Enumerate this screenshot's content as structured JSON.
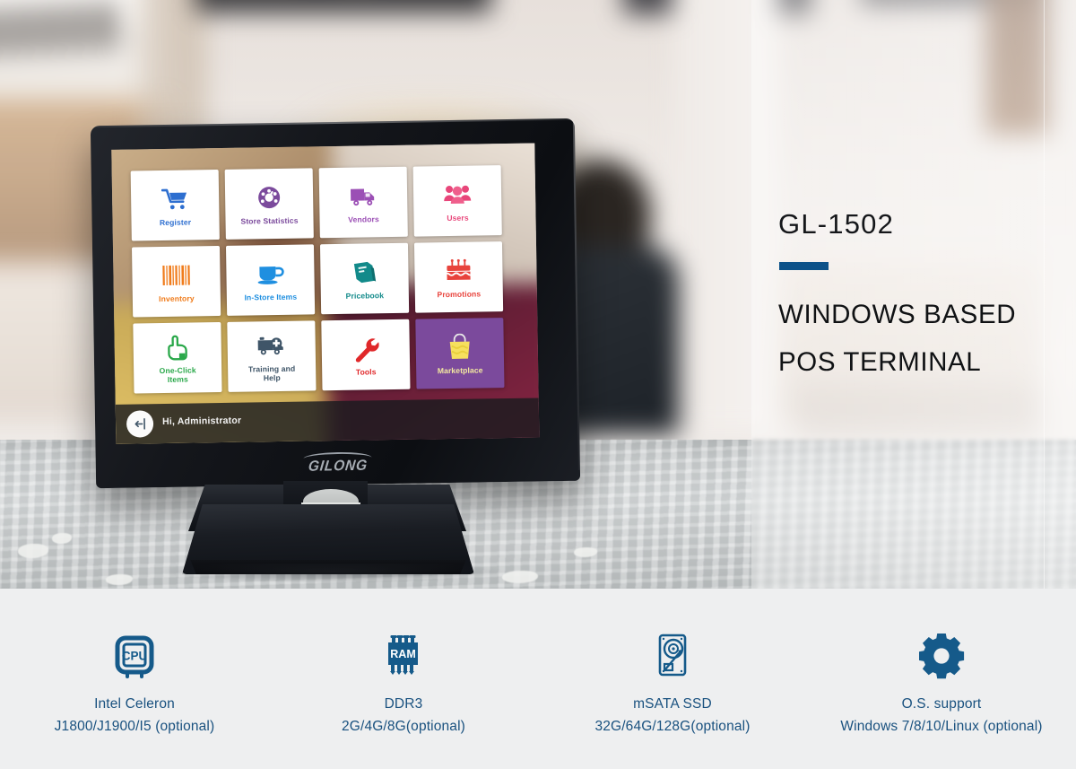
{
  "hero": {
    "product_code": "GL-1502",
    "title_line1": "WINDOWS BASED",
    "title_line2": "POS TERMINAL",
    "accent_color": "#0d5289"
  },
  "device": {
    "brand_logo": "GILONG",
    "taskbar": {
      "user_greeting": "Hi, Administrator",
      "avatar_icon": "logout-arrow-icon"
    },
    "tiles": [
      {
        "label": "Register",
        "icon": "shopping-cart-icon",
        "color": "#2e6fd0"
      },
      {
        "label": "Store Statistics",
        "icon": "gauge-icon",
        "color": "#7b4a9c"
      },
      {
        "label": "Vendors",
        "icon": "delivery-truck-icon",
        "color": "#9b4fb5"
      },
      {
        "label": "Users",
        "icon": "users-group-icon",
        "color": "#e8467a"
      },
      {
        "label": "Inventory",
        "icon": "barcode-icon",
        "color": "#f07c1c"
      },
      {
        "label": "In-Store Items",
        "icon": "coffee-cup-icon",
        "color": "#1f8fe0"
      },
      {
        "label": "Pricebook",
        "icon": "book-icon",
        "color": "#128a8a"
      },
      {
        "label": "Promotions",
        "icon": "birthday-cake-icon",
        "color": "#e8433c"
      },
      {
        "label": "One-Click\nItems",
        "icon": "pointing-hand-icon",
        "color": "#2aa84a"
      },
      {
        "label": "Training and\nHelp",
        "icon": "ambulance-icon",
        "color": "#3f5568"
      },
      {
        "label": "Tools",
        "icon": "wrench-icon",
        "color": "#e0282a"
      },
      {
        "label": "Marketplace",
        "icon": "shopping-bag-icon",
        "color": "#f6e05e"
      }
    ]
  },
  "specs": [
    {
      "icon": "cpu-chip-icon",
      "title": "Intel Celeron",
      "sub": "J1800/J1900/I5 (optional)"
    },
    {
      "icon": "ram-chip-icon",
      "title": "DDR3",
      "sub": "2G/4G/8G(optional)"
    },
    {
      "icon": "hard-drive-icon",
      "title": "mSATA SSD",
      "sub": "32G/64G/128G(optional)"
    },
    {
      "icon": "gear-icon",
      "title": "O.S. support",
      "sub": "Windows 7/8/10/Linux (optional)"
    }
  ],
  "theme": {
    "spec_text_color": "#19517f",
    "spec_bar_bg": "#eeeff0",
    "tile_accent_bg": "#7b4a9c"
  }
}
